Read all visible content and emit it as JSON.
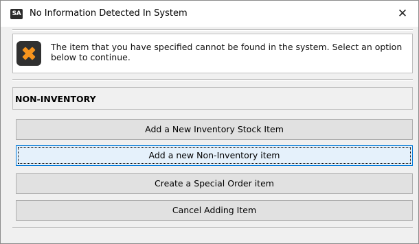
{
  "window": {
    "app_icon_text": "SA",
    "title": "No Information Detected In System",
    "close_glyph": "✕"
  },
  "message": {
    "icon": "error-x-icon",
    "icon_color": "#f7941d",
    "text": "The item that you have specified cannot be found in the system.  Select an option below to continue."
  },
  "section": {
    "label": "NON-INVENTORY"
  },
  "buttons": [
    {
      "label": "Add a New Inventory Stock Item",
      "focused": false
    },
    {
      "label": "Add a new Non-Inventory item",
      "focused": true
    },
    {
      "label": "Create a Special Order item",
      "focused": false
    },
    {
      "label": "Cancel Adding Item",
      "focused": false
    }
  ],
  "colors": {
    "focus_border": "#0078d7",
    "focus_fill": "#e5f1fb",
    "button_fill": "#e1e1e1",
    "dialog_bg": "#f0f0f0"
  }
}
